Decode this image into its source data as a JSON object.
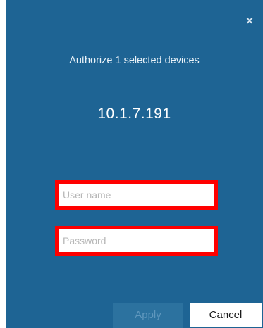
{
  "dialog": {
    "close_icon": "×",
    "title": "Authorize 1 selected devices",
    "device_ip": "10.1.7.191",
    "username": {
      "value": "",
      "placeholder": "User name"
    },
    "password": {
      "value": "",
      "placeholder": "Password"
    },
    "apply_label": "Apply",
    "apply_enabled": false,
    "cancel_label": "Cancel",
    "colors": {
      "background": "#1e6494",
      "highlight_border": "#ff0000",
      "divider": "#5d93b8"
    }
  }
}
